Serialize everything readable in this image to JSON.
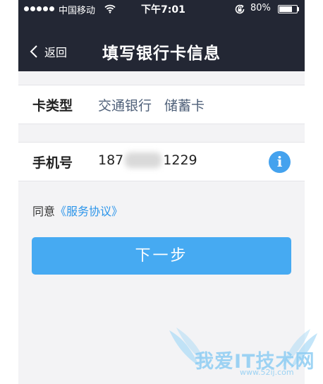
{
  "status_bar": {
    "carrier": "中国移动",
    "time": "下午7:01",
    "battery": "80%",
    "battery_level": 0.8,
    "icons": [
      "signal-dots",
      "wifi-icon",
      "rotation-lock-icon",
      "battery-icon"
    ]
  },
  "nav": {
    "back_label": "返回",
    "title": "填写银行卡信息"
  },
  "card_type": {
    "label": "卡类型",
    "bank": "交通银行",
    "kind": "储蓄卡"
  },
  "phone": {
    "label": "手机号",
    "prefix": "187",
    "suffix": "1229",
    "info_icon": "i"
  },
  "agreement": {
    "prefix": "同意",
    "link": "《服务协议》"
  },
  "next_button": "下一步",
  "watermark": {
    "text": "我爱IT技术网",
    "sub": "www.52ij.com"
  },
  "colors": {
    "header_bg": "#232734",
    "accent": "#46aaf2",
    "link": "#2c95ea",
    "page_bg": "#f3f3f5"
  }
}
